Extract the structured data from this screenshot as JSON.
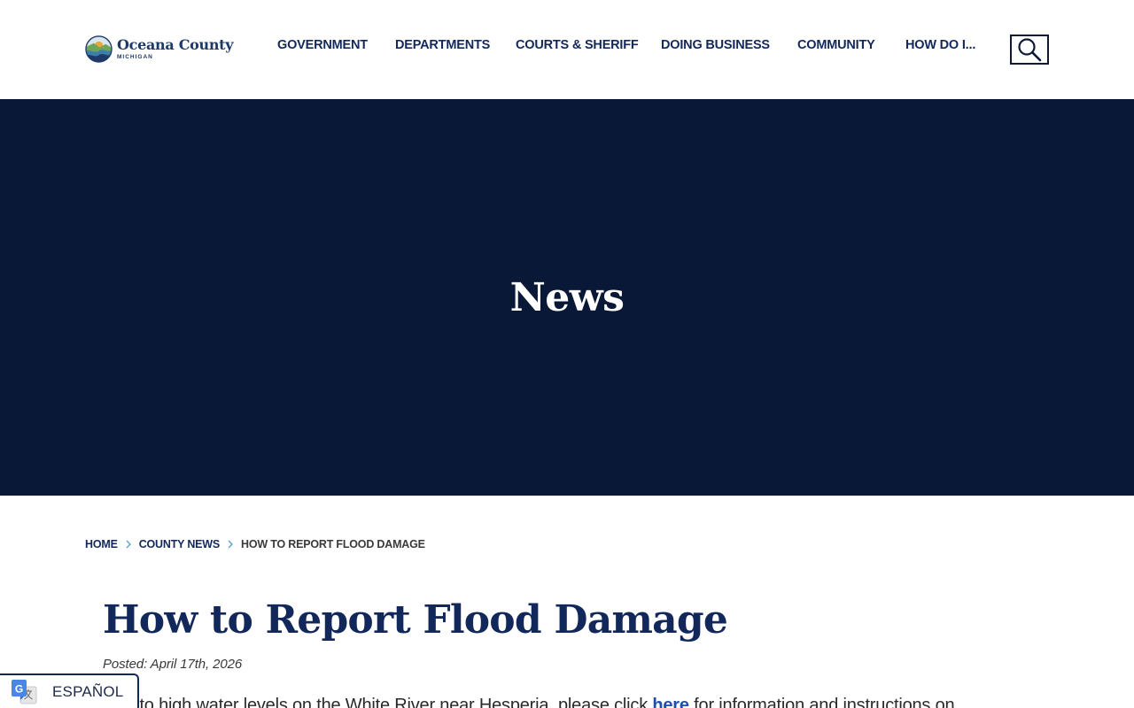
{
  "header": {
    "logo": {
      "name": "Oceana County",
      "state": "MICHIGAN"
    },
    "nav": [
      {
        "label": "GOVERNMENT"
      },
      {
        "label": "DEPARTMENTS"
      },
      {
        "label": "COURTS & SHERIFF"
      },
      {
        "label": "DOING BUSINESS"
      },
      {
        "label": "COMMUNITY"
      },
      {
        "label": "HOW DO I..."
      }
    ],
    "search_icon": "search-icon"
  },
  "hero": {
    "title": "News"
  },
  "breadcrumb": [
    {
      "label": "HOME"
    },
    {
      "label": "COUNTY NEWS"
    },
    {
      "label": "HOW TO REPORT FLOOD DAMAGE"
    }
  ],
  "article": {
    "title": "How to Report Flood Damage",
    "posted": "Posted: April 17th, 2026",
    "body_before": "Due to high water levels on the White River near Hesperia, please click ",
    "body_link": "here",
    "body_after": " for information and instructions on"
  },
  "translate": {
    "label": "ESPAÑOL",
    "icon": "google-translate-icon"
  },
  "colors": {
    "navy": "#0a1838",
    "nav_text": "#13285a",
    "link": "#1f4ea8",
    "chevron": "#5ba3c9"
  }
}
